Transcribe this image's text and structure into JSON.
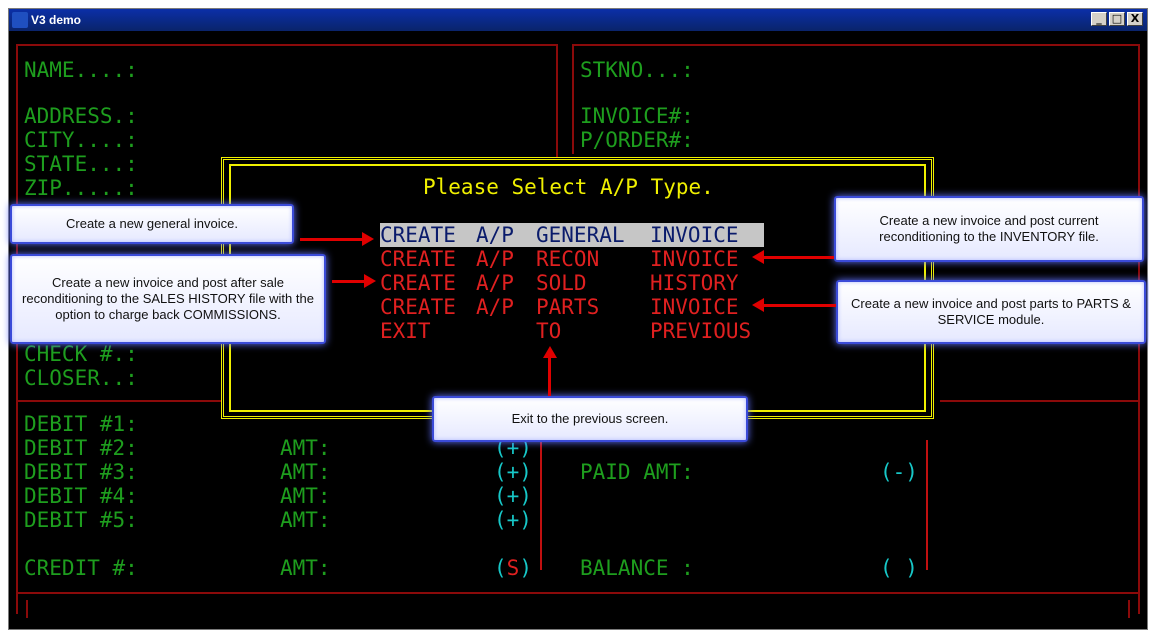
{
  "window": {
    "title": "V3 demo",
    "minimize": "_",
    "maximize": "□",
    "close": "X"
  },
  "left_fields": {
    "name": "NAME....:",
    "address": "ADDRESS.:",
    "city": "CITY....:",
    "state": "STATE...:",
    "zip": "ZIP.....:",
    "check": "CHECK #.:",
    "closer": "CLOSER..:"
  },
  "right_fields": {
    "stkno": "STKNO...:",
    "invoice": "INVOICE#:",
    "porder": "P/ORDER#:"
  },
  "debits": [
    {
      "label": "DEBIT #1:",
      "amt": "",
      "sign": ""
    },
    {
      "label": "DEBIT #2:",
      "amt": "AMT:",
      "sign": "(+)"
    },
    {
      "label": "DEBIT #3:",
      "amt": "AMT:",
      "sign": "(+)"
    },
    {
      "label": "DEBIT #4:",
      "amt": "AMT:",
      "sign": "(+)"
    },
    {
      "label": "DEBIT #5:",
      "amt": "AMT:",
      "sign": "(+)"
    }
  ],
  "credit": {
    "label": "CREDIT #:",
    "amt": "AMT:",
    "sign_open": "(",
    "sign_char": "S",
    "sign_close": ")"
  },
  "totals": {
    "paid_label": "PAID AMT:",
    "paid_sign": "(-)",
    "balance_label": "BALANCE :",
    "balance_sign": "( )"
  },
  "dialog": {
    "title": "Please Select A/P Type.",
    "options": [
      {
        "c1": "CREATE",
        "c2": "A/P",
        "c3": "GENERAL",
        "c4": "INVOICE",
        "selected": true
      },
      {
        "c1": "CREATE",
        "c2": "A/P",
        "c3": "RECON",
        "c4": "INVOICE",
        "selected": false
      },
      {
        "c1": "CREATE",
        "c2": "A/P",
        "c3": "SOLD",
        "c4": "HISTORY",
        "selected": false
      },
      {
        "c1": "CREATE",
        "c2": "A/P",
        "c3": "PARTS",
        "c4": "INVOICE",
        "selected": false
      },
      {
        "c1": "EXIT",
        "c2": "",
        "c3": "TO",
        "c4": "PREVIOUS",
        "selected": false
      }
    ]
  },
  "callouts": {
    "general": "Create a new general invoice.",
    "sold": "Create a new invoice and post after sale reconditioning to the SALES HISTORY file with the option to charge back COMMISSIONS.",
    "recon": "Create a new invoice and post current reconditioning to the INVENTORY file.",
    "parts": "Create a new invoice and post parts to PARTS & SERVICE module.",
    "exit": "Exit to the previous screen."
  },
  "colors": {
    "green": "#1e9e1e",
    "cyan": "#17c7c7",
    "red": "#e02020",
    "yellow": "#f0f000",
    "selected_bg": "#c6c6c6"
  }
}
